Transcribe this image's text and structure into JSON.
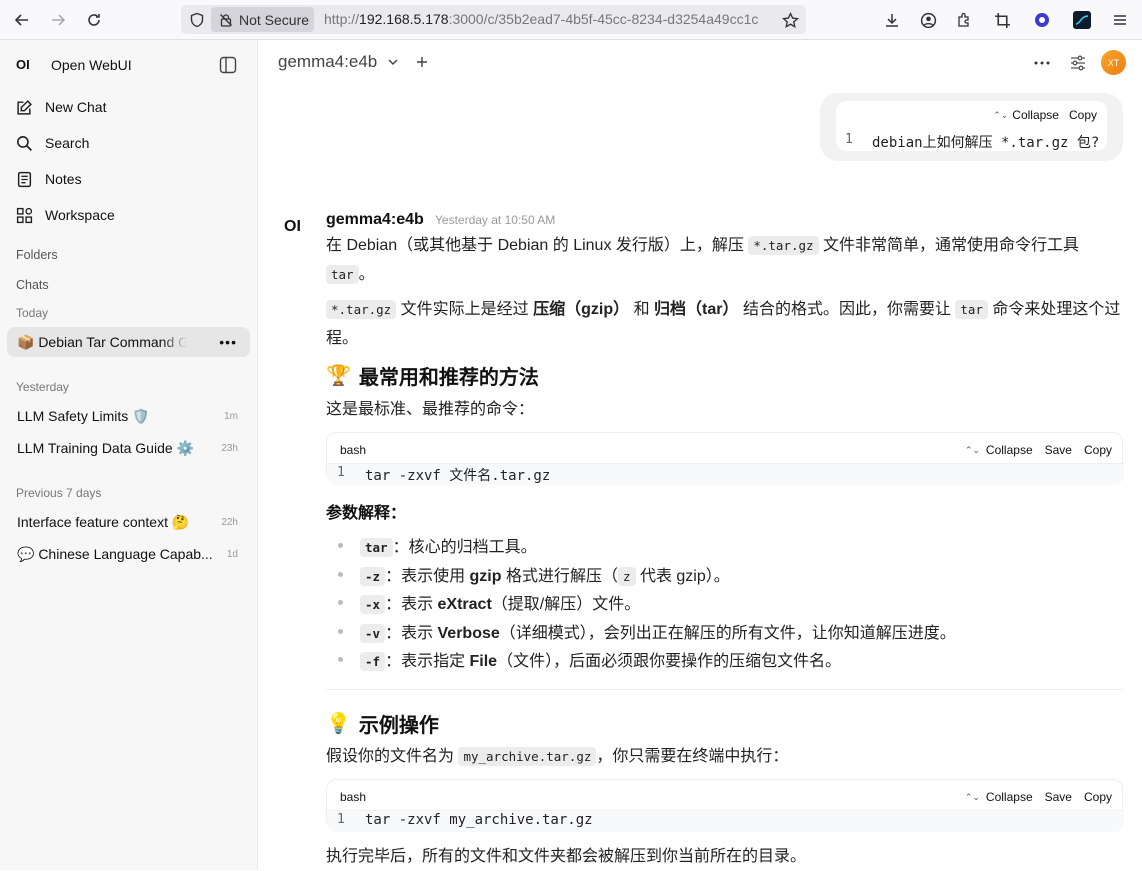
{
  "browser": {
    "not_secure": "Not Secure",
    "url_prefix": "http://",
    "url_host": "192.168.5.178",
    "url_rest": ":3000/c/35b2ead7-4b5f-45cc-8234-d3254a49cc1c"
  },
  "sidebar": {
    "logo": "OI",
    "app_name": "Open WebUI",
    "nav": {
      "new_chat": "New Chat",
      "search": "Search",
      "notes": "Notes",
      "workspace": "Workspace"
    },
    "folders_label": "Folders",
    "chats_label": "Chats",
    "today_label": "Today",
    "today_chats": [
      {
        "title": "📦 Debian Tar Command Gui"
      }
    ],
    "yesterday_label": "Yesterday",
    "yesterday_chats": [
      {
        "title": "LLM Safety Limits 🛡️",
        "time": "1m"
      },
      {
        "title": "LLM Training Data Guide ⚙️",
        "time": "23h"
      }
    ],
    "prev7_label": "Previous 7 days",
    "prev7_chats": [
      {
        "title": "Interface feature context 🤔",
        "time": "22h"
      },
      {
        "title": "💬 Chinese Language Capab...",
        "time": "1d"
      }
    ]
  },
  "header": {
    "model": "gemma4:e4b",
    "avatar": "XT"
  },
  "user_message": {
    "collapse": "Collapse",
    "copy": "Copy",
    "line_no": "1",
    "code": "debian上如何解压 *.tar.gz 包?"
  },
  "assistant": {
    "logo": "OI",
    "name": "gemma4:e4b",
    "time": "Yesterday at 10:50 AM",
    "p1_a": "在 Debian（或其他基于 Debian 的 Linux 发行版）上，解压 ",
    "p1_code": "*.tar.gz",
    "p1_b": " 文件非常简单，通常使用命令行工具",
    "p1_code2": "tar",
    "p1_c": "。",
    "p2_code": "*.tar.gz",
    "p2_a": " 文件实际上是经过 ",
    "p2_b1": "压缩（gzip）",
    "p2_and": " 和 ",
    "p2_b2": "归档（tar）",
    "p2_c": " 结合的格式。因此，你需要让 ",
    "p2_code2": "tar",
    "p2_d": " 命令来处理这个过程。",
    "h1_icon": "🏆",
    "h1": "最常用和推荐的方法",
    "p3": "这是最标准、最推荐的命令：",
    "code1": {
      "lang": "bash",
      "collapse": "Collapse",
      "save": "Save",
      "copy": "Copy",
      "line_no": "1",
      "code": "tar -zxvf 文件名.tar.gz"
    },
    "params_heading": "参数解释：",
    "params": [
      {
        "flag": "tar",
        "pre": "：核心的归档工具。",
        "bold": "",
        "post": "",
        "code2": "",
        "post2": ""
      },
      {
        "flag": "-z",
        "pre": "：表示使用 ",
        "bold": "gzip",
        "post": " 格式进行解压（",
        "code2": "z",
        "post2": " 代表 gzip）。"
      },
      {
        "flag": "-x",
        "pre": "：表示 ",
        "bold": "eXtract",
        "post": "（提取/解压）文件。",
        "code2": "",
        "post2": ""
      },
      {
        "flag": "-v",
        "pre": "：表示 ",
        "bold": "Verbose",
        "post": "（详细模式），会列出正在解压的所有文件，让你知道解压进度。",
        "code2": "",
        "post2": ""
      },
      {
        "flag": "-f",
        "pre": "：表示指定 ",
        "bold": "File",
        "post": "（文件），后面必须跟你要操作的压缩包文件名。",
        "code2": "",
        "post2": ""
      }
    ],
    "h2_icon": "💡",
    "h2": "示例操作",
    "p4_a": "假设你的文件名为 ",
    "p4_code": "my_archive.tar.gz",
    "p4_b": "，你只需要在终端中执行：",
    "code2": {
      "lang": "bash",
      "collapse": "Collapse",
      "save": "Save",
      "copy": "Copy",
      "line_no": "1",
      "code": "tar -zxvf my_archive.tar.gz"
    },
    "p5": "执行完毕后，所有的文件和文件夹都会被解压到你当前所在的目录。"
  }
}
